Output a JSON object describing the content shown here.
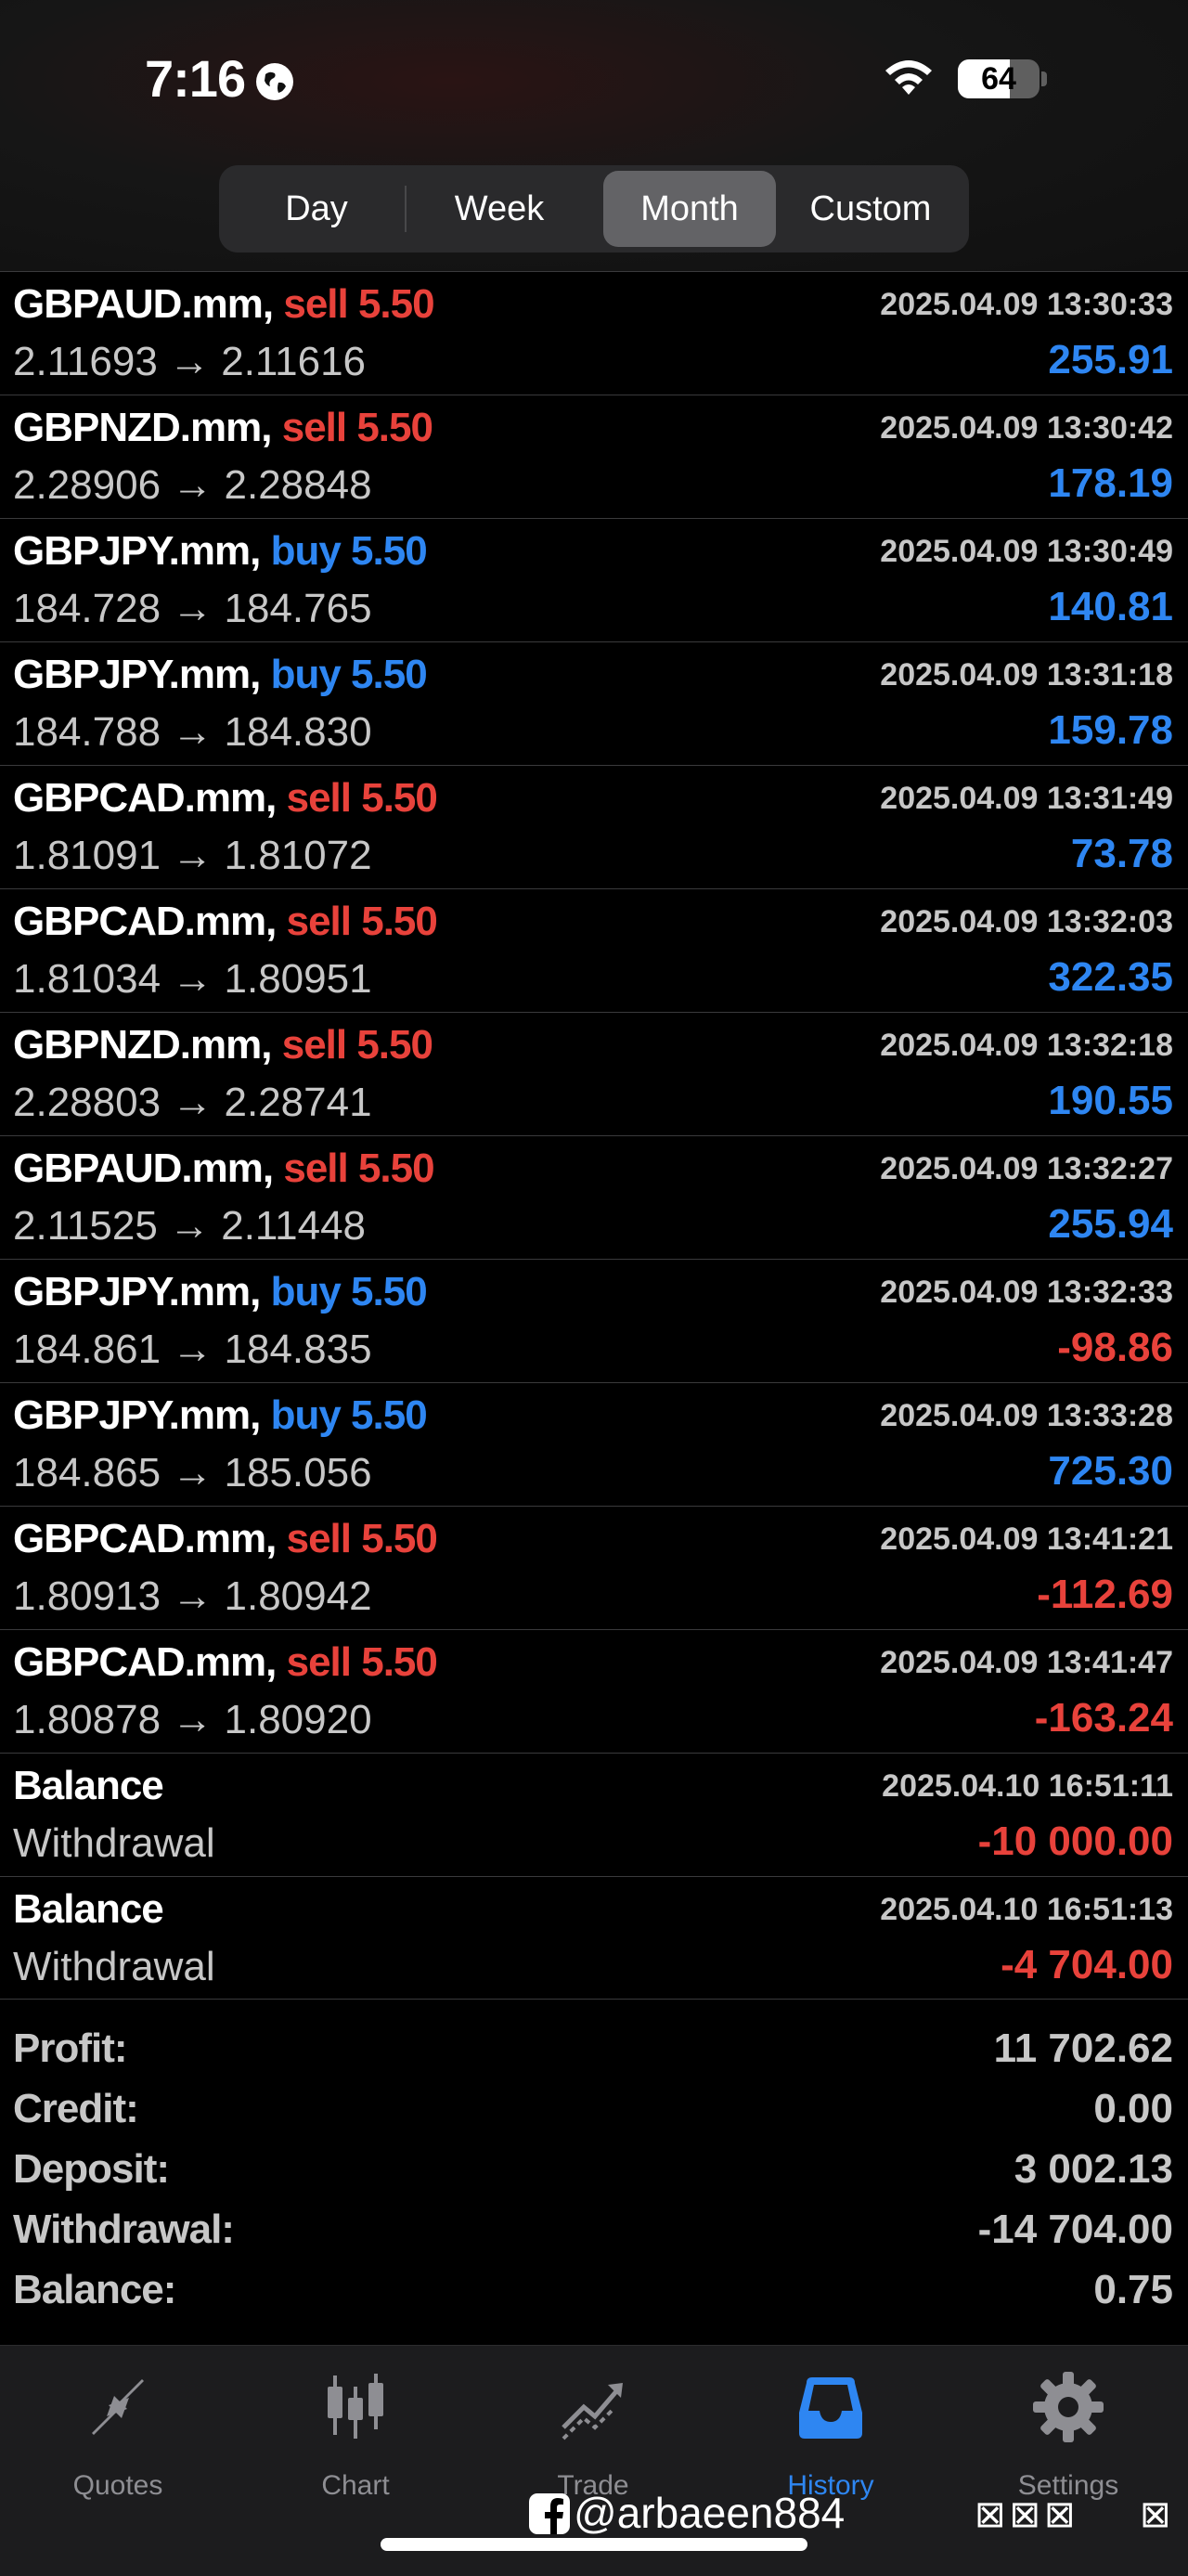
{
  "status_bar": {
    "time": "7:16",
    "battery": "64",
    "battery_level": 64
  },
  "period_tabs": {
    "items": [
      {
        "label": "Day",
        "active": false
      },
      {
        "label": "Week",
        "active": false
      },
      {
        "label": "Month",
        "active": true
      },
      {
        "label": "Custom",
        "active": false
      }
    ]
  },
  "trades": [
    {
      "symbol": "GBPAUD.mm,",
      "side": "sell",
      "volume": "sell 5.50",
      "prices": "2.11693 → 2.11616",
      "time": "2025.04.09 13:30:33",
      "profit": "255.91",
      "sign": "pos"
    },
    {
      "symbol": "GBPNZD.mm,",
      "side": "sell",
      "volume": "sell 5.50",
      "prices": "2.28906 → 2.28848",
      "time": "2025.04.09 13:30:42",
      "profit": "178.19",
      "sign": "pos"
    },
    {
      "symbol": "GBPJPY.mm,",
      "side": "buy",
      "volume": "buy 5.50",
      "prices": "184.728 → 184.765",
      "time": "2025.04.09 13:30:49",
      "profit": "140.81",
      "sign": "pos"
    },
    {
      "symbol": "GBPJPY.mm,",
      "side": "buy",
      "volume": "buy 5.50",
      "prices": "184.788 → 184.830",
      "time": "2025.04.09 13:31:18",
      "profit": "159.78",
      "sign": "pos"
    },
    {
      "symbol": "GBPCAD.mm,",
      "side": "sell",
      "volume": "sell 5.50",
      "prices": "1.81091 → 1.81072",
      "time": "2025.04.09 13:31:49",
      "profit": "73.78",
      "sign": "pos"
    },
    {
      "symbol": "GBPCAD.mm,",
      "side": "sell",
      "volume": "sell 5.50",
      "prices": "1.81034 → 1.80951",
      "time": "2025.04.09 13:32:03",
      "profit": "322.35",
      "sign": "pos"
    },
    {
      "symbol": "GBPNZD.mm,",
      "side": "sell",
      "volume": "sell 5.50",
      "prices": "2.28803 → 2.28741",
      "time": "2025.04.09 13:32:18",
      "profit": "190.55",
      "sign": "pos"
    },
    {
      "symbol": "GBPAUD.mm,",
      "side": "sell",
      "volume": "sell 5.50",
      "prices": "2.11525 → 2.11448",
      "time": "2025.04.09 13:32:27",
      "profit": "255.94",
      "sign": "pos"
    },
    {
      "symbol": "GBPJPY.mm,",
      "side": "buy",
      "volume": "buy 5.50",
      "prices": "184.861 → 184.835",
      "time": "2025.04.09 13:32:33",
      "profit": "-98.86",
      "sign": "neg"
    },
    {
      "symbol": "GBPJPY.mm,",
      "side": "buy",
      "volume": "buy 5.50",
      "prices": "184.865 → 185.056",
      "time": "2025.04.09 13:33:28",
      "profit": "725.30",
      "sign": "pos"
    },
    {
      "symbol": "GBPCAD.mm,",
      "side": "sell",
      "volume": "sell 5.50",
      "prices": "1.80913 → 1.80942",
      "time": "2025.04.09 13:41:21",
      "profit": "-112.69",
      "sign": "neg"
    },
    {
      "symbol": "GBPCAD.mm,",
      "side": "sell",
      "volume": "sell 5.50",
      "prices": "1.80878 → 1.80920",
      "time": "2025.04.09 13:41:47",
      "profit": "-163.24",
      "sign": "neg"
    }
  ],
  "balance_ops": [
    {
      "title": "Balance",
      "type": "Withdrawal",
      "time": "2025.04.10 16:51:11",
      "amount": "-10 000.00",
      "sign": "neg"
    },
    {
      "title": "Balance",
      "type": "Withdrawal",
      "time": "2025.04.10 16:51:13",
      "amount": "-4 704.00",
      "sign": "neg"
    }
  ],
  "summary": [
    {
      "label": "Profit:",
      "value": "11 702.62"
    },
    {
      "label": "Credit:",
      "value": "0.00"
    },
    {
      "label": "Deposit:",
      "value": "3 002.13"
    },
    {
      "label": "Withdrawal:",
      "value": "-14 704.00"
    },
    {
      "label": "Balance:",
      "value": "0.75"
    }
  ],
  "tab_bar": {
    "items": [
      {
        "label": "Quotes",
        "icon": "quotes-icon",
        "active": false
      },
      {
        "label": "Chart",
        "icon": "chart-icon",
        "active": false
      },
      {
        "label": "Trade",
        "icon": "trade-icon",
        "active": false
      },
      {
        "label": "History",
        "icon": "history-icon",
        "active": true
      },
      {
        "label": "Settings",
        "icon": "settings-icon",
        "active": false
      }
    ]
  },
  "watermark": {
    "text": "@arbaeen884",
    "boxes": "⊠⊠⊠",
    "box_last": "⊠"
  },
  "colors": {
    "sell": "#e8423b",
    "buy": "#2e86f2",
    "positive": "#2e86f2",
    "negative": "#e8423b",
    "active_tab": "#2e86f2",
    "inactive_tab": "#8e8e93"
  }
}
